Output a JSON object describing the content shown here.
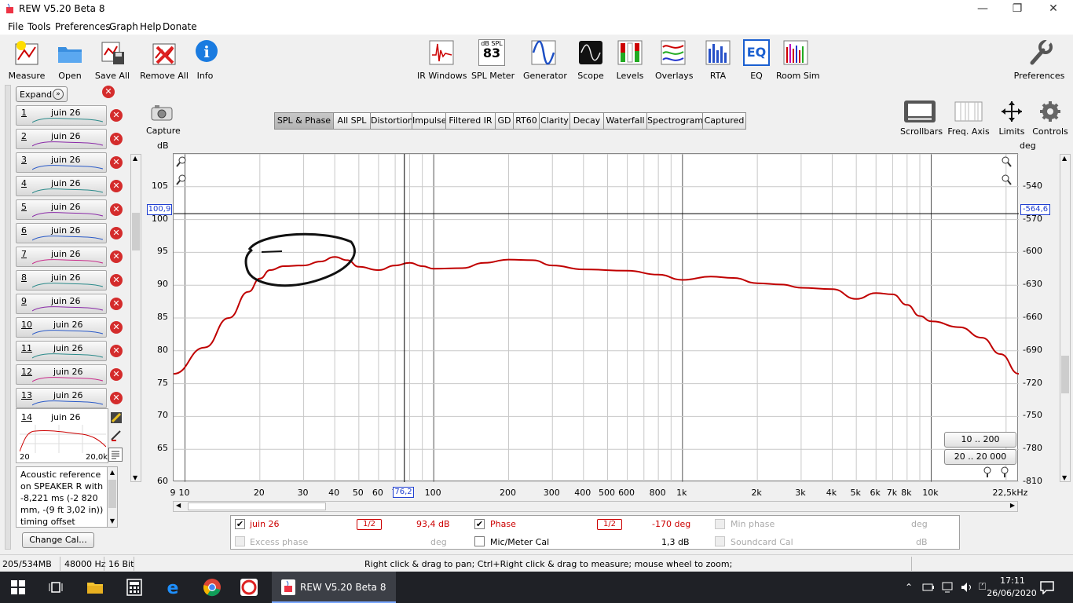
{
  "window": {
    "title": "REW V5.20 Beta 8",
    "controls": [
      "—",
      "❐",
      "✕"
    ]
  },
  "menu": [
    "File",
    "Tools",
    "Preferences",
    "Graph",
    "Help",
    "Donate"
  ],
  "toolbar_left": [
    {
      "label": "Measure"
    },
    {
      "label": "Open"
    },
    {
      "label": "Save All"
    },
    {
      "label": "Remove All"
    },
    {
      "label": "Info"
    }
  ],
  "toolbar_center": [
    {
      "label": "IR Windows"
    },
    {
      "label": "SPL Meter",
      "badge_top": "dB SPL",
      "badge_value": "83"
    },
    {
      "label": "Generator"
    },
    {
      "label": "Scope"
    },
    {
      "label": "Levels"
    },
    {
      "label": "Overlays"
    },
    {
      "label": "RTA"
    },
    {
      "label": "EQ",
      "badge_value": "EQ"
    },
    {
      "label": "Room Sim"
    }
  ],
  "toolbar_right": {
    "label": "Preferences"
  },
  "left_panel": {
    "expand_label": "Expand",
    "measurements": [
      {
        "num": "1",
        "date": "juin 26"
      },
      {
        "num": "2",
        "date": "juin 26"
      },
      {
        "num": "3",
        "date": "juin 26"
      },
      {
        "num": "4",
        "date": "juin 26"
      },
      {
        "num": "5",
        "date": "juin 26"
      },
      {
        "num": "6",
        "date": "juin 26"
      },
      {
        "num": "7",
        "date": "juin 26"
      },
      {
        "num": "8",
        "date": "juin 26"
      },
      {
        "num": "9",
        "date": "juin 26"
      },
      {
        "num": "10",
        "date": "juin 26"
      },
      {
        "num": "11",
        "date": "juin 26"
      },
      {
        "num": "12",
        "date": "juin 26"
      },
      {
        "num": "13",
        "date": "juin 26"
      }
    ],
    "selected": {
      "num": "14",
      "date": "juin 26",
      "x_min": "20",
      "x_max": "20,0k"
    },
    "notes": "Acoustic reference on SPEAKER R with -8,221 ms (-2 820 mm, -(9 ft 3,02 in)) timing offset",
    "change_cal_label": "Change Cal..."
  },
  "capture_label": "Capture",
  "graph_tabs": [
    "SPL & Phase",
    "All SPL",
    "Distortion",
    "Impulse",
    "Filtered IR",
    "GD",
    "RT60",
    "Clarity",
    "Decay",
    "Waterfall",
    "Spectrogram",
    "Captured"
  ],
  "active_tab": "SPL & Phase",
  "graph_controls": [
    {
      "label": "Scrollbars"
    },
    {
      "label": "Freq. Axis"
    },
    {
      "label": "Limits"
    },
    {
      "label": "Controls"
    }
  ],
  "range_buttons": [
    "10 .. 200",
    "20 .. 20 000"
  ],
  "cursor": {
    "left_readout": "100,9",
    "right_readout": "-564,6",
    "freq_readout": "76,2"
  },
  "chart_data": {
    "type": "line",
    "xlabel": "",
    "ylabel": "dB",
    "ylabel_right": "deg",
    "xunit": "kHz",
    "x_scale": "log",
    "xlim": [
      9,
      22500
    ],
    "ylim": [
      60,
      110
    ],
    "ylim_right": [
      -810,
      -510
    ],
    "y_ticks": [
      "105",
      "100",
      "95",
      "90",
      "85",
      "80",
      "75",
      "70",
      "65",
      "60"
    ],
    "y_right_ticks": [
      "-540",
      "-570",
      "-600",
      "-630",
      "-660",
      "-690",
      "-720",
      "-750",
      "-780",
      "-810"
    ],
    "x_tick_labels": [
      {
        "f": 9,
        "t": "9"
      },
      {
        "f": 10,
        "t": "10"
      },
      {
        "f": 20,
        "t": "20"
      },
      {
        "f": 30,
        "t": "30"
      },
      {
        "f": 40,
        "t": "40"
      },
      {
        "f": 50,
        "t": "50"
      },
      {
        "f": 60,
        "t": "60"
      },
      {
        "f": 70,
        "t": "7"
      },
      {
        "f": 100,
        "t": "100"
      },
      {
        "f": 200,
        "t": "200"
      },
      {
        "f": 300,
        "t": "300"
      },
      {
        "f": 400,
        "t": "400"
      },
      {
        "f": 500,
        "t": "500"
      },
      {
        "f": 600,
        "t": "600"
      },
      {
        "f": 800,
        "t": "800"
      },
      {
        "f": 1000,
        "t": "1k"
      },
      {
        "f": 2000,
        "t": "2k"
      },
      {
        "f": 3000,
        "t": "3k"
      },
      {
        "f": 4000,
        "t": "4k"
      },
      {
        "f": 5000,
        "t": "5k"
      },
      {
        "f": 6000,
        "t": "6k"
      },
      {
        "f": 7000,
        "t": "7k"
      },
      {
        "f": 8000,
        "t": "8k"
      },
      {
        "f": 10000,
        "t": "10k"
      },
      {
        "f": 22500,
        "t": "22,5kHz"
      }
    ],
    "cursor_x": 76.2,
    "cursor_y": 100.9,
    "series": [
      {
        "name": "juin 26",
        "color": "#c00000",
        "points": [
          [
            9,
            76.5
          ],
          [
            12,
            80.5
          ],
          [
            15,
            85
          ],
          [
            18,
            89
          ],
          [
            20,
            91
          ],
          [
            22,
            92.3
          ],
          [
            25,
            92.9
          ],
          [
            30,
            93
          ],
          [
            35,
            93.6
          ],
          [
            40,
            94.3
          ],
          [
            45,
            93.8
          ],
          [
            50,
            92.8
          ],
          [
            60,
            92.3
          ],
          [
            70,
            93
          ],
          [
            80,
            93.4
          ],
          [
            90,
            92.9
          ],
          [
            100,
            92.5
          ],
          [
            130,
            92.6
          ],
          [
            160,
            93.4
          ],
          [
            200,
            93.9
          ],
          [
            250,
            93.8
          ],
          [
            300,
            93
          ],
          [
            400,
            92.4
          ],
          [
            600,
            92.2
          ],
          [
            800,
            91.6
          ],
          [
            1000,
            90.8
          ],
          [
            1300,
            91.3
          ],
          [
            1600,
            91.1
          ],
          [
            2000,
            90.3
          ],
          [
            2500,
            90.1
          ],
          [
            3000,
            89.6
          ],
          [
            4000,
            89.4
          ],
          [
            5000,
            87.9
          ],
          [
            6000,
            88.8
          ],
          [
            7000,
            88.6
          ],
          [
            8000,
            87
          ],
          [
            9000,
            85.3
          ],
          [
            10000,
            84.5
          ],
          [
            13000,
            83.6
          ],
          [
            16000,
            82
          ],
          [
            19000,
            79.5
          ],
          [
            22500,
            76.5
          ]
        ]
      }
    ]
  },
  "legend": {
    "row1": {
      "name": "juin 26",
      "octave": "1/2",
      "value": "93,4 dB",
      "phase_label": "Phase",
      "phase_octave": "1/2",
      "phase_value": "-170 deg",
      "min_phase_label": "Min phase",
      "min_phase_unit": "deg"
    },
    "row2": {
      "excess_label": "Excess phase",
      "excess_unit": "deg",
      "mic_label": "Mic/Meter Cal",
      "mic_value": "1,3 dB",
      "sc_label": "Soundcard Cal",
      "sc_unit": "dB"
    }
  },
  "status": {
    "memory": "205/534MB",
    "rate": "48000 Hz",
    "bits": "16 Bit",
    "hint": "Right click & drag to pan; Ctrl+Right click & drag to measure; mouse wheel to zoom;"
  },
  "taskbar": {
    "app_label": "REW V5.20 Beta 8",
    "time": "17:11",
    "date": "26/06/2020"
  },
  "colors": {
    "trace": "#c00000",
    "cursor_box": "#1f3fd0"
  }
}
